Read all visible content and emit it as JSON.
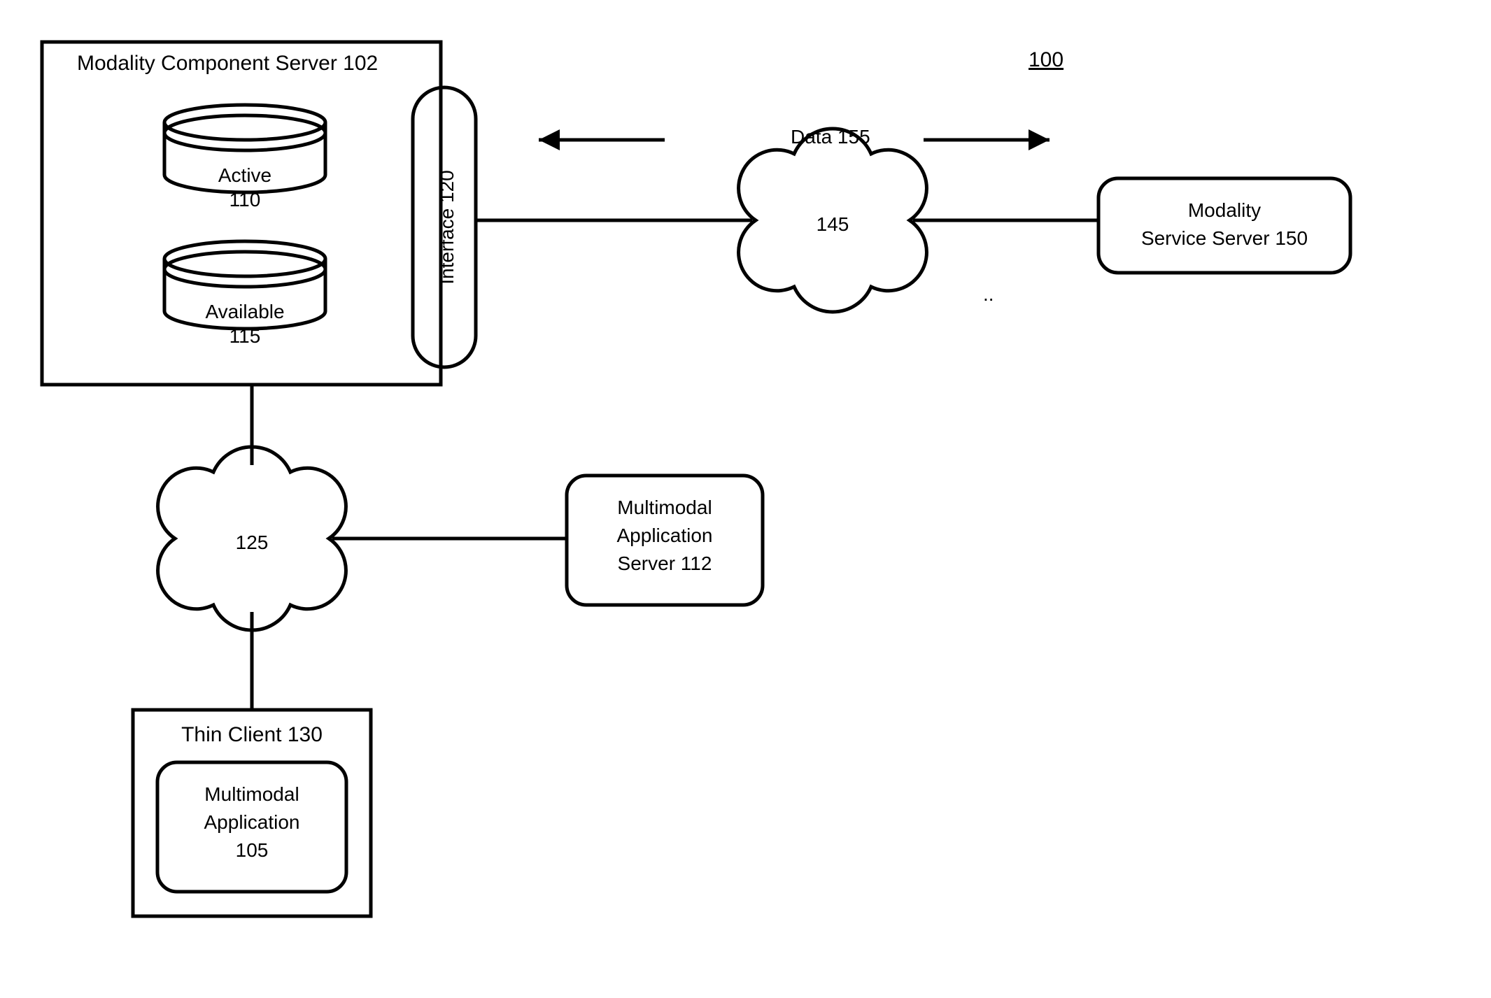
{
  "figure_number": "100",
  "modality_component_server": {
    "title": "Modality Component Server 102",
    "db_active": {
      "label": "Active",
      "num": "110"
    },
    "db_available": {
      "label": "Available",
      "num": "115"
    },
    "interface": {
      "label": "Interface 120"
    }
  },
  "cloud_125": "125",
  "cloud_145": "145",
  "data_label": "Data 155",
  "multimodal_app_server": {
    "line1": "Multimodal",
    "line2": "Application",
    "line3": "Server 112"
  },
  "thin_client": {
    "title": "Thin Client 130",
    "app": {
      "line1": "Multimodal",
      "line2": "Application",
      "num": "105"
    }
  },
  "modality_service_server": {
    "line1": "Modality",
    "line2": "Service Server 150"
  }
}
